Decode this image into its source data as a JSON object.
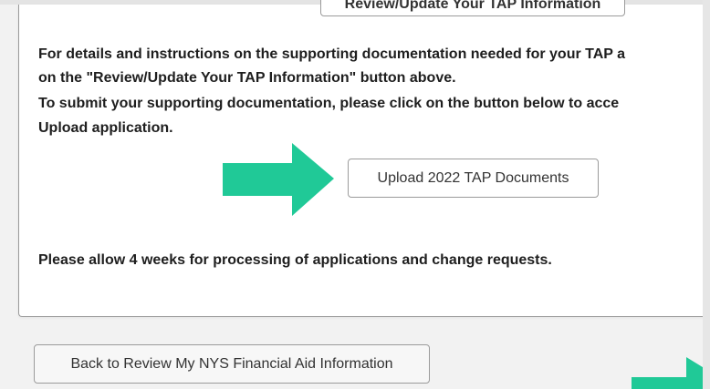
{
  "top_button": {
    "label": "Review/Update Your TAP Information"
  },
  "instructions": {
    "line1": "For details and instructions on the supporting documentation needed for your TAP a",
    "line2": "on the \"Review/Update Your TAP Information\" button above.",
    "line3": "To submit your supporting documentation, please click on the button below to acce",
    "line4": "Upload application."
  },
  "upload_button": {
    "label": "Upload 2022 TAP Documents"
  },
  "processing_note": "Please allow 4 weeks for processing of applications and change requests.",
  "back_button": {
    "label": "Back to Review My NYS Financial Aid Information"
  },
  "colors": {
    "arrow": "#20c997",
    "panel_border": "#9a9a9a",
    "page_bg": "#f2f2f2"
  },
  "icons": {
    "pointer": "arrow-right-icon"
  }
}
